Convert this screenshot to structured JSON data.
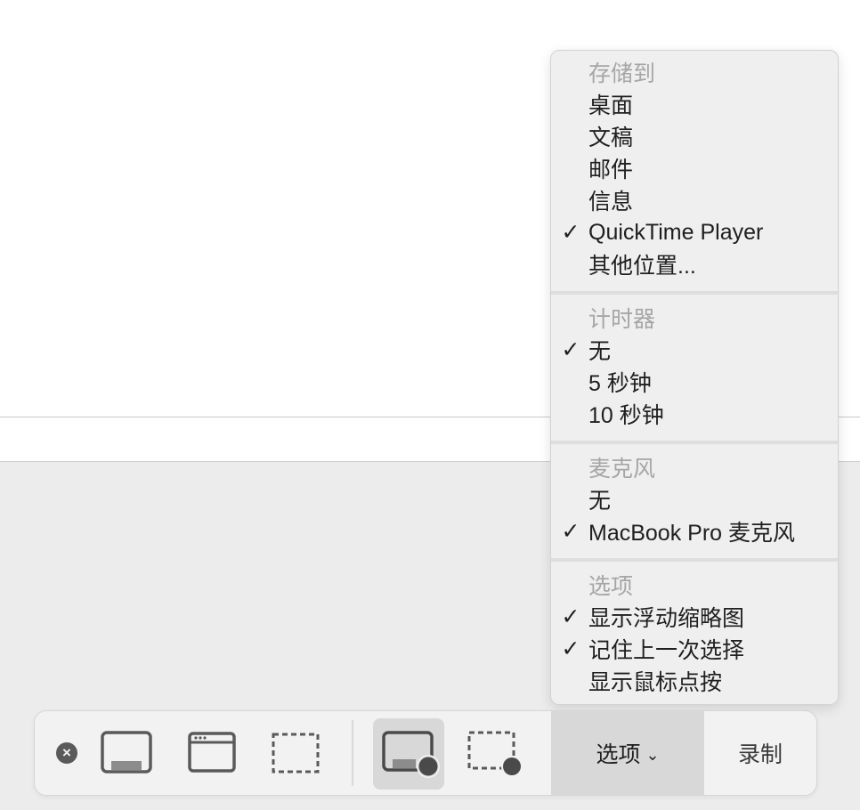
{
  "menu": {
    "sections": [
      {
        "header": "存储到",
        "items": [
          {
            "label": "桌面",
            "checked": false
          },
          {
            "label": "文稿",
            "checked": false
          },
          {
            "label": "邮件",
            "checked": false
          },
          {
            "label": "信息",
            "checked": false
          },
          {
            "label": "QuickTime Player",
            "checked": true
          },
          {
            "label": "其他位置...",
            "checked": false
          }
        ]
      },
      {
        "header": "计时器",
        "items": [
          {
            "label": "无",
            "checked": true
          },
          {
            "label": "5 秒钟",
            "checked": false
          },
          {
            "label": "10 秒钟",
            "checked": false
          }
        ]
      },
      {
        "header": "麦克风",
        "items": [
          {
            "label": "无",
            "checked": false
          },
          {
            "label": "MacBook Pro 麦克风",
            "checked": true
          }
        ]
      },
      {
        "header": "选项",
        "items": [
          {
            "label": "显示浮动缩略图",
            "checked": true
          },
          {
            "label": "记住上一次选择",
            "checked": true
          },
          {
            "label": "显示鼠标点按",
            "checked": false
          }
        ]
      }
    ],
    "check_glyph": "✓"
  },
  "toolbar": {
    "close_glyph": "×",
    "options_label": "选项",
    "options_chevron": "⌄",
    "record_label": "录制",
    "tools": [
      {
        "icon": "capture-entire-screen-icon"
      },
      {
        "icon": "capture-window-icon"
      },
      {
        "icon": "capture-selection-icon"
      },
      {
        "icon": "record-entire-screen-icon",
        "selected": true
      },
      {
        "icon": "record-selection-icon"
      }
    ]
  },
  "colors": {
    "menu_bg": "#efefef",
    "menu_header": "#a6a6a6",
    "menu_text": "#1f1f1f",
    "toolbar_bg": "#f2f2f2",
    "selected_bg": "#d8d8d8",
    "desktop_bottom": "#ececec"
  }
}
